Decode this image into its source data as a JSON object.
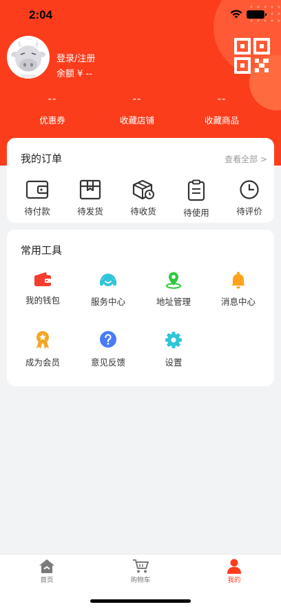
{
  "status_bar": {
    "time": "2:04"
  },
  "profile": {
    "login_label": "登录/注册",
    "balance_label": "余额 ¥ --"
  },
  "stats": [
    {
      "value": "--",
      "label": "优惠券"
    },
    {
      "value": "--",
      "label": "收藏店铺"
    },
    {
      "value": "--",
      "label": "收藏商品"
    }
  ],
  "orders": {
    "title": "我的订单",
    "view_all": "查看全部 >",
    "items": [
      {
        "label": "待付款",
        "icon": "wallet-icon"
      },
      {
        "label": "待发货",
        "icon": "box-icon"
      },
      {
        "label": "待收货",
        "icon": "package-clock-icon"
      },
      {
        "label": "待使用",
        "icon": "clipboard-icon"
      },
      {
        "label": "待评价",
        "icon": "clock-icon"
      }
    ]
  },
  "tools": {
    "title": "常用工具",
    "items": [
      {
        "label": "我的钱包",
        "icon": "wallet-icon",
        "color": "#f53d2d"
      },
      {
        "label": "服务中心",
        "icon": "headset-icon",
        "color": "#2ec5d9"
      },
      {
        "label": "地址管理",
        "icon": "location-pin-icon",
        "color": "#2fc940"
      },
      {
        "label": "消息中心",
        "icon": "bell-icon",
        "color": "#ffa31a"
      },
      {
        "label": "成为会员",
        "icon": "medal-icon",
        "color": "#f5a623"
      },
      {
        "label": "意见反馈",
        "icon": "question-icon",
        "color": "#4a7bf5"
      },
      {
        "label": "设置",
        "icon": "gear-icon",
        "color": "#2ec5d9"
      }
    ]
  },
  "tabbar": {
    "items": [
      {
        "label": "首页",
        "icon": "home-icon"
      },
      {
        "label": "购物车",
        "icon": "cart-icon"
      },
      {
        "label": "我的",
        "icon": "person-icon",
        "active": true
      }
    ]
  },
  "colors": {
    "brand": "#fc3d1c",
    "background": "#f2f3f5"
  }
}
